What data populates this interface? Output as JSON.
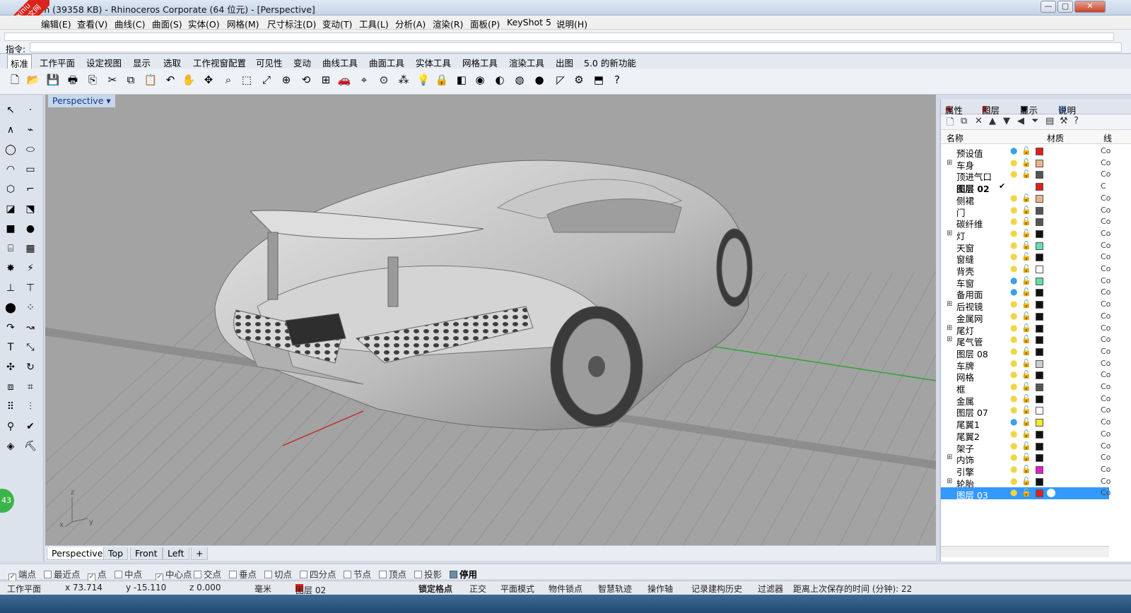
{
  "window": {
    "title": "m (39358 KB) - Rhinoceros Corporate (64 位元) - [Perspective]",
    "controls": [
      "—",
      "▢",
      "✕"
    ]
  },
  "watermark": {
    "line1": "xuexiniu",
    "line2": "学犀牛中文网"
  },
  "menu": [
    "编辑(E)",
    "查看(V)",
    "曲线(C)",
    "曲面(S)",
    "实体(O)",
    "网格(M)",
    "尺寸标注(D)",
    "变动(T)",
    "工具(L)",
    "分析(A)",
    "渲染(R)",
    "面板(P)",
    "KeyShot 5",
    "说明(H)"
  ],
  "command": {
    "label": "指令:",
    "value": ""
  },
  "toolbar_tabs": [
    "标准",
    "工作平面",
    "设定视图",
    "显示",
    "选取",
    "工作视窗配置",
    "可见性",
    "变动",
    "曲线工具",
    "曲面工具",
    "实体工具",
    "网格工具",
    "渲染工具",
    "出图",
    "5.0 的新功能"
  ],
  "toolbar_icons": [
    "new-icon",
    "open-icon",
    "save-icon",
    "print-icon",
    "import-icon",
    "cut-icon",
    "copy-icon",
    "paste-icon",
    "undo-icon",
    "pan-hand-icon",
    "move-view-icon",
    "zoom-icon",
    "zoom-window-icon",
    "zoom-extents-icon",
    "zoom-selected-icon",
    "rotate-view-icon",
    "four-view-icon",
    "car-icon",
    "grid-snap-icon",
    "point-icon",
    "points-icon",
    "light-icon",
    "lock-icon",
    "layer-icon",
    "color-wheel-icon",
    "shade-icon",
    "render-sphere-icon",
    "material-sphere-icon",
    "dimension-icon",
    "settings-gear-icon",
    "select-icon",
    "help-icon"
  ],
  "toolbar_glyphs": [
    "🗋",
    "📂",
    "💾",
    "🖶",
    "⎘",
    "✂",
    "⧉",
    "📋",
    "↶",
    "✋",
    "✥",
    "⌕",
    "⬚",
    "⤢",
    "⊕",
    "⟲",
    "⊞",
    "🚗",
    "⌖",
    "⊙",
    "⁂",
    "💡",
    "🔒",
    "◧",
    "◉",
    "◐",
    "◍",
    "●",
    "◸",
    "⚙",
    "⬒",
    "?"
  ],
  "viewport": {
    "label": "Perspective",
    "menu_arrow": "▾",
    "axis_x": "x",
    "axis_y": "y",
    "axis_z": "z"
  },
  "viewport_tabs": [
    "Perspective",
    "Top",
    "Front",
    "Left",
    "+"
  ],
  "panel": {
    "tabs": [
      "属性",
      "图层",
      "显示",
      "说明"
    ],
    "col_name": "名称",
    "col_material": "材质",
    "col_cut": "线",
    "layers": [
      {
        "name": "预设值",
        "expand": "",
        "color": "#e0201c",
        "bulb": "#3aa0e8",
        "bold": false,
        "cut": "Co"
      },
      {
        "name": "车身",
        "expand": "⊞",
        "color": "#e8b48c",
        "bulb": "#f2d448",
        "bold": false,
        "cut": "Co"
      },
      {
        "name": "顶进气口",
        "expand": "",
        "color": "#555555",
        "bulb": "#f2d448",
        "bold": false,
        "cut": "Co"
      },
      {
        "name": "图层 02",
        "expand": "",
        "color": "#e0201c",
        "bulb": "",
        "bold": true,
        "cut": "C"
      },
      {
        "name": "侧裙",
        "expand": "",
        "color": "#e8b48c",
        "bulb": "#f2d448",
        "bold": false,
        "cut": "Co"
      },
      {
        "name": "门",
        "expand": "",
        "color": "#555555",
        "bulb": "#f2d448",
        "bold": false,
        "cut": "Co"
      },
      {
        "name": "碳纤维",
        "expand": "",
        "color": "#555555",
        "bulb": "#f2d448",
        "bold": false,
        "cut": "Co"
      },
      {
        "name": "灯",
        "expand": "⊞",
        "color": "#111111",
        "bulb": "#f2d448",
        "bold": false,
        "cut": "Co"
      },
      {
        "name": "天窗",
        "expand": "",
        "color": "#62e0a8",
        "bulb": "#f2d448",
        "bold": false,
        "cut": "Co"
      },
      {
        "name": "窗缝",
        "expand": "",
        "color": "#111111",
        "bulb": "#f2d448",
        "bold": false,
        "cut": "Co"
      },
      {
        "name": "背壳",
        "expand": "",
        "color": "#ffffff",
        "bulb": "#f2d448",
        "bold": false,
        "cut": "Co"
      },
      {
        "name": "车窗",
        "expand": "",
        "color": "#62e0a8",
        "bulb": "#3aa0e8",
        "bold": false,
        "cut": "Co"
      },
      {
        "name": "备用面",
        "expand": "",
        "color": "#111111",
        "bulb": "#3aa0e8",
        "bold": false,
        "cut": "Co"
      },
      {
        "name": "后视镜",
        "expand": "⊞",
        "color": "#111111",
        "bulb": "#f2d448",
        "bold": false,
        "cut": "Co"
      },
      {
        "name": "金属网",
        "expand": "",
        "color": "#111111",
        "bulb": "#f2d448",
        "bold": false,
        "cut": "Co"
      },
      {
        "name": "尾灯",
        "expand": "⊞",
        "color": "#111111",
        "bulb": "#f2d448",
        "bold": false,
        "cut": "Co"
      },
      {
        "name": "尾气管",
        "expand": "⊞",
        "color": "#111111",
        "bulb": "#f2d448",
        "bold": false,
        "cut": "Co"
      },
      {
        "name": "图层 08",
        "expand": "",
        "color": "#111111",
        "bulb": "#f2d448",
        "bold": false,
        "cut": "Co"
      },
      {
        "name": "车牌",
        "expand": "",
        "color": "#cccccc",
        "bulb": "#f2d448",
        "bold": false,
        "cut": "Co"
      },
      {
        "name": "网格",
        "expand": "",
        "color": "#111111",
        "bulb": "#f2d448",
        "bold": false,
        "cut": "Co"
      },
      {
        "name": "框",
        "expand": "",
        "color": "#555555",
        "bulb": "#f2d448",
        "bold": false,
        "cut": "Co"
      },
      {
        "name": "金属",
        "expand": "",
        "color": "#111111",
        "bulb": "#f2d448",
        "bold": false,
        "cut": "Co"
      },
      {
        "name": "图层 07",
        "expand": "",
        "color": "#ffffff",
        "bulb": "#f2d448",
        "bold": false,
        "cut": "Co"
      },
      {
        "name": "尾翼1",
        "expand": "",
        "color": "#f2ea2a",
        "bulb": "#3aa0e8",
        "bold": false,
        "cut": "Co"
      },
      {
        "name": "尾翼2",
        "expand": "",
        "color": "#111111",
        "bulb": "#f2d448",
        "bold": false,
        "cut": "Co"
      },
      {
        "name": "架子",
        "expand": "",
        "color": "#111111",
        "bulb": "#f2d448",
        "bold": false,
        "cut": "Co"
      },
      {
        "name": "内饰",
        "expand": "⊞",
        "color": "#111111",
        "bulb": "#f2d448",
        "bold": false,
        "cut": "Co"
      },
      {
        "name": "引擎",
        "expand": "",
        "color": "#e020c8",
        "bulb": "#f2d448",
        "bold": false,
        "cut": "Co"
      },
      {
        "name": "轮胎",
        "expand": "⊞",
        "color": "#111111",
        "bulb": "#f2d448",
        "bold": false,
        "cut": "Co"
      },
      {
        "name": "图层 03",
        "expand": "",
        "color": "#e0201c",
        "bulb": "#f2d448",
        "bold": false,
        "cut": "Co",
        "selected": true
      }
    ],
    "current_mark": "✔"
  },
  "osnaps": [
    {
      "label": "端点",
      "checked": true
    },
    {
      "label": "最近点",
      "checked": false
    },
    {
      "label": "点",
      "checked": true
    },
    {
      "label": "中点",
      "checked": false
    },
    {
      "label": "中心点",
      "checked": true
    },
    {
      "label": "交点",
      "checked": false
    },
    {
      "label": "垂点",
      "checked": false
    },
    {
      "label": "切点",
      "checked": false
    },
    {
      "label": "四分点",
      "checked": false
    },
    {
      "label": "节点",
      "checked": false
    },
    {
      "label": "顶点",
      "checked": false
    },
    {
      "label": "投影",
      "checked": false
    },
    {
      "label": "停用",
      "checked": false
    }
  ],
  "status": {
    "cplane": "工作平面",
    "x": "x 73.714",
    "y": "y -15.110",
    "z": "z 0.000",
    "units": "毫米",
    "layer": "图层 02",
    "layer_color": "#e0201c",
    "grid_snap": "锁定格点",
    "ortho": "正交",
    "planar": "平面模式",
    "osnap": "物件锁点",
    "smarttrack": "智慧轨迹",
    "gumball": "操作轴",
    "history": "记录建构历史",
    "filter": "过滤器",
    "autosave": "距离上次保存的时间 (分钟): 22"
  },
  "badge": "43"
}
